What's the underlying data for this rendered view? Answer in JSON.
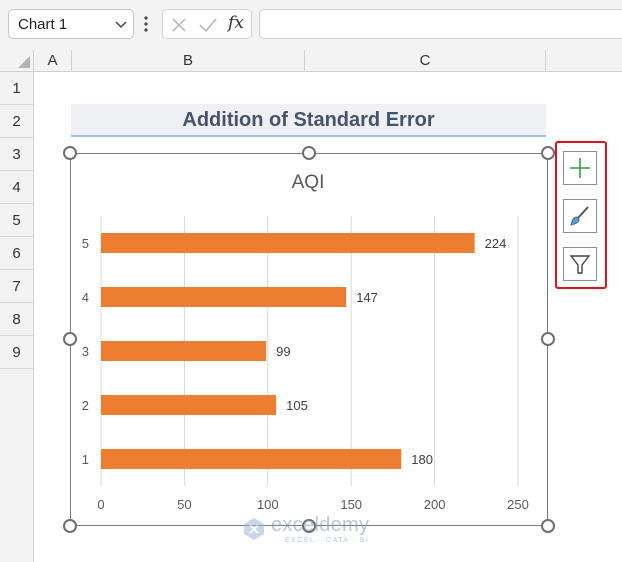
{
  "namebox": {
    "value": "Chart 1"
  },
  "formula_bar": {
    "fx_label": "fx",
    "value": ""
  },
  "columns": [
    "A",
    "B",
    "C"
  ],
  "rows": [
    "1",
    "2",
    "3",
    "4",
    "5",
    "6",
    "7",
    "8",
    "9"
  ],
  "sheet": {
    "title_cell": "Addition of Standard Error"
  },
  "chart_data": {
    "type": "bar",
    "orientation": "horizontal",
    "title": "AQI",
    "categories": [
      "1",
      "2",
      "3",
      "4",
      "5"
    ],
    "values": [
      180,
      105,
      99,
      147,
      224
    ],
    "data_labels": [
      "180",
      "105",
      "99",
      "147",
      "224"
    ],
    "xlim": [
      0,
      250
    ],
    "x_ticks": [
      "0",
      "50",
      "100",
      "150",
      "200",
      "250"
    ],
    "grid": "vertical",
    "bar_color": "#ed7d31"
  },
  "chart_buttons": [
    {
      "icon": "plus-icon",
      "label": "Chart Elements"
    },
    {
      "icon": "brush-icon",
      "label": "Chart Styles"
    },
    {
      "icon": "filter-icon",
      "label": "Chart Filters"
    }
  ],
  "watermark": {
    "name": "exceldemy",
    "tagline": "EXCEL · DATA · BI"
  },
  "colors": {
    "accent_border": "#e0111b",
    "title_text": "#44546a",
    "title_underline": "#9dc3e6"
  }
}
